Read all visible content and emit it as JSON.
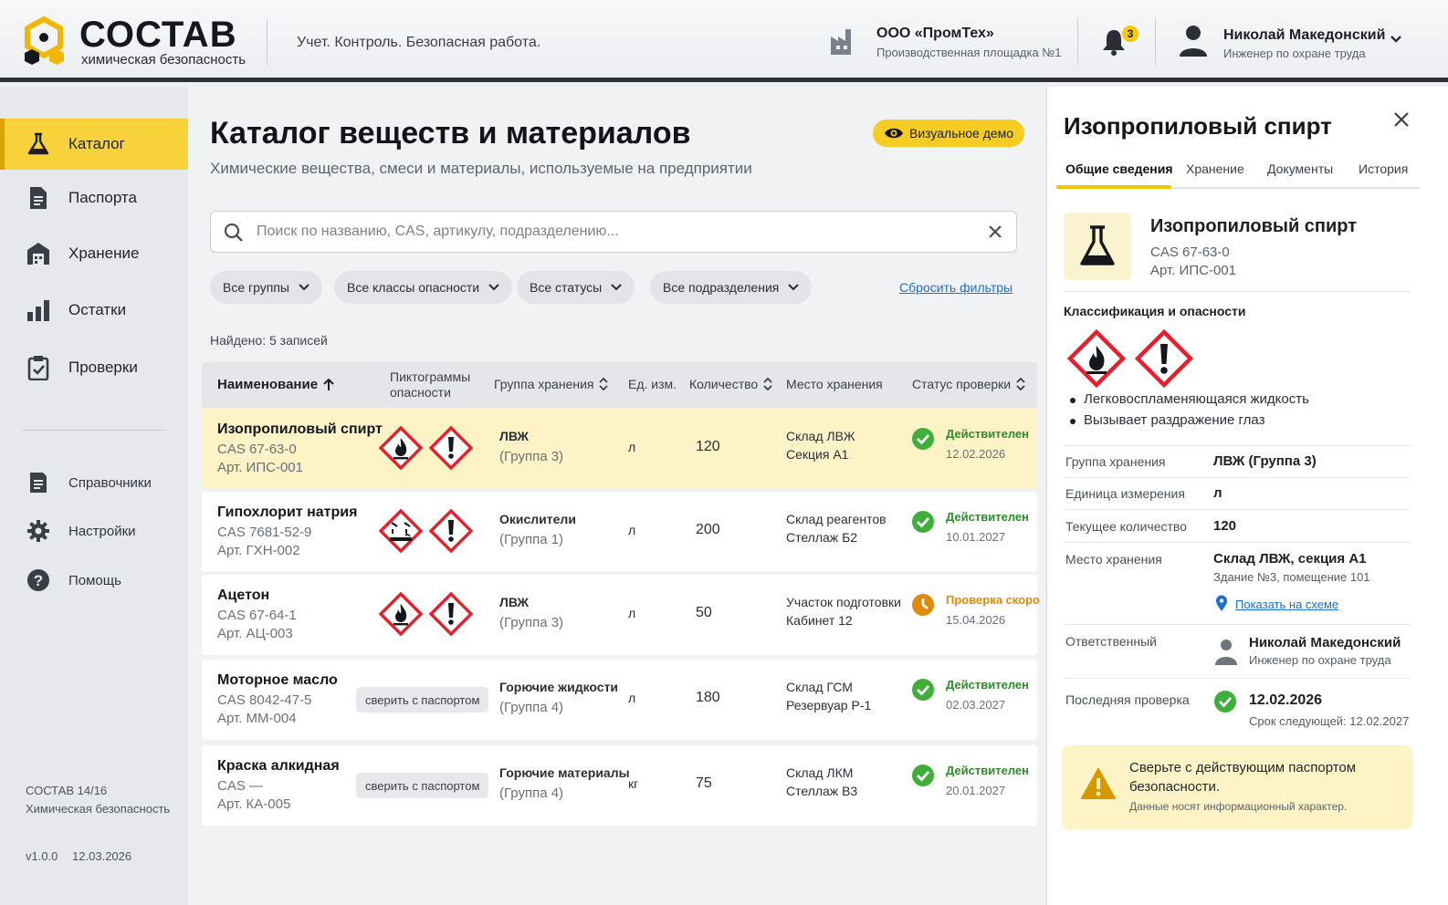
{
  "header": {
    "brand": "СОСТАВ",
    "brand_sub": "химическая безопасность",
    "slogan": "Учет. Контроль. Безопасная работа.",
    "company": "ООО «ПромТех»",
    "site": "Производственная площадка №1",
    "notifications": "3",
    "user_name": "Николай Македонский",
    "user_role": "Инженер по охране труда"
  },
  "sidebar": {
    "items": [
      {
        "label": "Каталог",
        "icon": "flask-icon"
      },
      {
        "label": "Паспорта",
        "icon": "document-icon"
      },
      {
        "label": "Хранение",
        "icon": "warehouse-icon"
      },
      {
        "label": "Остатки",
        "icon": "bar-chart-icon"
      },
      {
        "label": "Проверки",
        "icon": "clipboard-check-icon"
      }
    ],
    "secondary": [
      {
        "label": "Справочники",
        "icon": "book-icon"
      },
      {
        "label": "Настройки",
        "icon": "gear-icon"
      },
      {
        "label": "Помощь",
        "icon": "help-icon"
      }
    ],
    "app_name": "СОСТАВ 14/16",
    "app_desc": "Химическая безопасность",
    "version": "v1.0.0",
    "date": "12.03.2026"
  },
  "main": {
    "title": "Каталог веществ и материалов",
    "subtitle": "Химические вещества, смеси и материалы, используемые на предприятии",
    "demo_label": "Визуальное демо",
    "search_placeholder": "Поиск по названию, CAS, артикулу, подразделению...",
    "filters": [
      "Все группы",
      "Все классы опасности",
      "Все статусы",
      "Все подразделения"
    ],
    "reset_label": "Сбросить фильтры",
    "found": "Найдено: 5 записей",
    "columns": {
      "name": "Наименование",
      "pictograms_1": "Пиктограммы",
      "pictograms_2": "опасности",
      "group": "Группа хранения",
      "unit": "Ед. изм.",
      "qty": "Количество",
      "place": "Место хранения",
      "status": "Статус проверки"
    },
    "rows": [
      {
        "name": "Изопропиловый спирт",
        "cas": "CAS 67-63-0",
        "art": "Арт. ИПС-001",
        "pictos": [
          "flame",
          "exclamation"
        ],
        "group": "ЛВЖ",
        "group_sub": "(Группа 3)",
        "unit": "л",
        "qty": "120",
        "place1": "Склад ЛВЖ",
        "place2": "Секция А1",
        "status": "Действителен",
        "status_date": "12.02.2026",
        "status_kind": "ok"
      },
      {
        "name": "Гипохлорит натрия",
        "cas": "CAS 7681-52-9",
        "art": "Арт. ГХН-002",
        "pictos": [
          "corrosion",
          "exclamation"
        ],
        "group": "Окислители",
        "group_sub": "(Группа 1)",
        "unit": "л",
        "qty": "200",
        "place1": "Склад реагентов",
        "place2": "Стеллаж Б2",
        "status": "Действителен",
        "status_date": "10.01.2027",
        "status_kind": "ok"
      },
      {
        "name": "Ацетон",
        "cas": "CAS 67-64-1",
        "art": "Арт. АЦ-003",
        "pictos": [
          "flame",
          "exclamation"
        ],
        "group": "ЛВЖ",
        "group_sub": "(Группа 3)",
        "unit": "л",
        "qty": "50",
        "place1": "Участок подготовки",
        "place2": "Кабинет 12",
        "status": "Проверка скоро",
        "status_date": "15.04.2026",
        "status_kind": "soon"
      },
      {
        "name": "Моторное масло",
        "cas": "CAS 8042-47-5",
        "art": "Арт. ММ-004",
        "tag": "сверить с паспортом",
        "group": "Горючие жидкости",
        "group_sub": "(Группа 4)",
        "unit": "л",
        "qty": "180",
        "place1": "Склад ГСМ",
        "place2": "Резервуар Р-1",
        "status": "Действителен",
        "status_date": "02.03.2027",
        "status_kind": "ok"
      },
      {
        "name": "Краска алкидная",
        "cas": "CAS —",
        "art": "Арт. КА-005",
        "tag": "сверить с паспортом",
        "group": "Горючие материалы",
        "group_sub": "(Группа 4)",
        "unit": "кг",
        "qty": "75",
        "place1": "Склад ЛКМ",
        "place2": "Стеллаж В3",
        "status": "Действителен",
        "status_date": "20.01.2027",
        "status_kind": "ok"
      }
    ]
  },
  "panel": {
    "title": "Изопропиловый спирт",
    "tabs": [
      "Общие сведения",
      "Хранение",
      "Документы",
      "История"
    ],
    "name": "Изопропиловый спирт",
    "cas": "CAS 67-63-0",
    "art": "Арт. ИПС-001",
    "class_heading": "Классификация и опасности",
    "hazards": [
      "Легковоспламеняющаяся жидкость",
      "Вызывает раздражение глаз"
    ],
    "fields": {
      "group_k": "Группа хранения",
      "group_v": "ЛВЖ (Группа 3)",
      "unit_k": "Единица измерения",
      "unit_v": "л",
      "qty_k": "Текущее количество",
      "qty_v": "120",
      "place_k": "Место хранения",
      "place_v": "Склад ЛВЖ, секция А1",
      "place_s": "Здание №3, помещение 101",
      "map_link": "Показать на схеме",
      "resp_k": "Ответственный",
      "resp_v": "Николай Македонский",
      "resp_s": "Инженер по охране труда",
      "check_k": "Последняя проверка",
      "check_v": "12.02.2026",
      "check_s": "Срок следующей: 12.02.2027"
    },
    "warning_1": "Сверьте с действующим паспортом безопасности.",
    "warning_2": "Данные носят информационный характер."
  },
  "colors": {
    "accent": "#f6cc22",
    "ok": "#3fae3a",
    "soon": "#e08a0b",
    "hazard": "#e3202b",
    "link": "#1b6fd1"
  }
}
